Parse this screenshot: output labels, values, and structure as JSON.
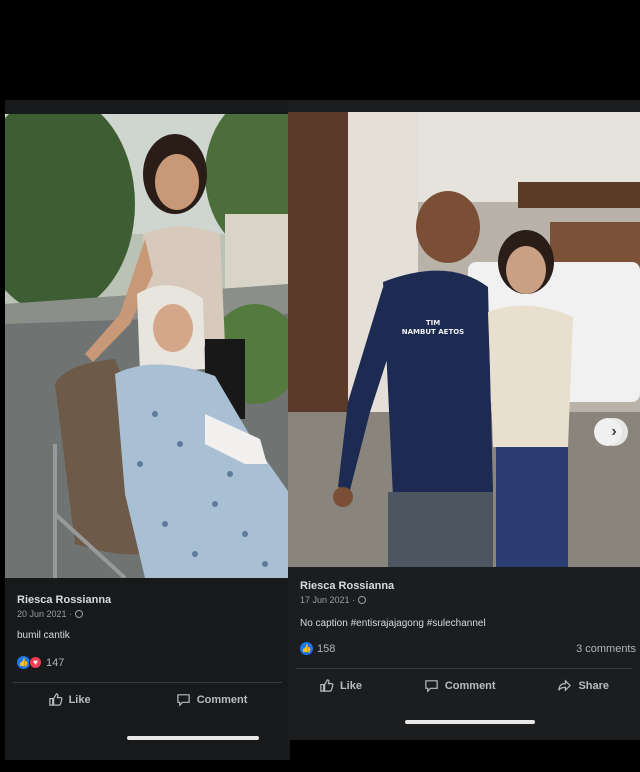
{
  "left_post": {
    "author": "Riesca Rossianna",
    "date": "20 Jun 2021 ·",
    "caption": "bumil cantik",
    "reaction_count": "147",
    "like_label": "Like",
    "comment_label": "Comment"
  },
  "right_post": {
    "author": "Riesca Rossianna",
    "date": "17 Jun 2021 ·",
    "caption": "No caption #entisrajajagong #sulechannel",
    "reaction_count": "158",
    "comments_count": "3 comments",
    "like_label": "Like",
    "comment_label": "Comment",
    "share_label": "Share",
    "shirt_text_line1": "TIM",
    "shirt_text_line2": "NAMBUT AETOS"
  },
  "colors": {
    "background": "#000000",
    "card": "#18191a",
    "like_blue": "#1877f2",
    "love_red": "#f33e58"
  },
  "icons": {
    "like": "thumbs-up-icon",
    "comment": "comment-bubble-icon",
    "share": "share-arrow-icon",
    "privacy": "globe-icon",
    "next": "chevron-right-icon"
  }
}
